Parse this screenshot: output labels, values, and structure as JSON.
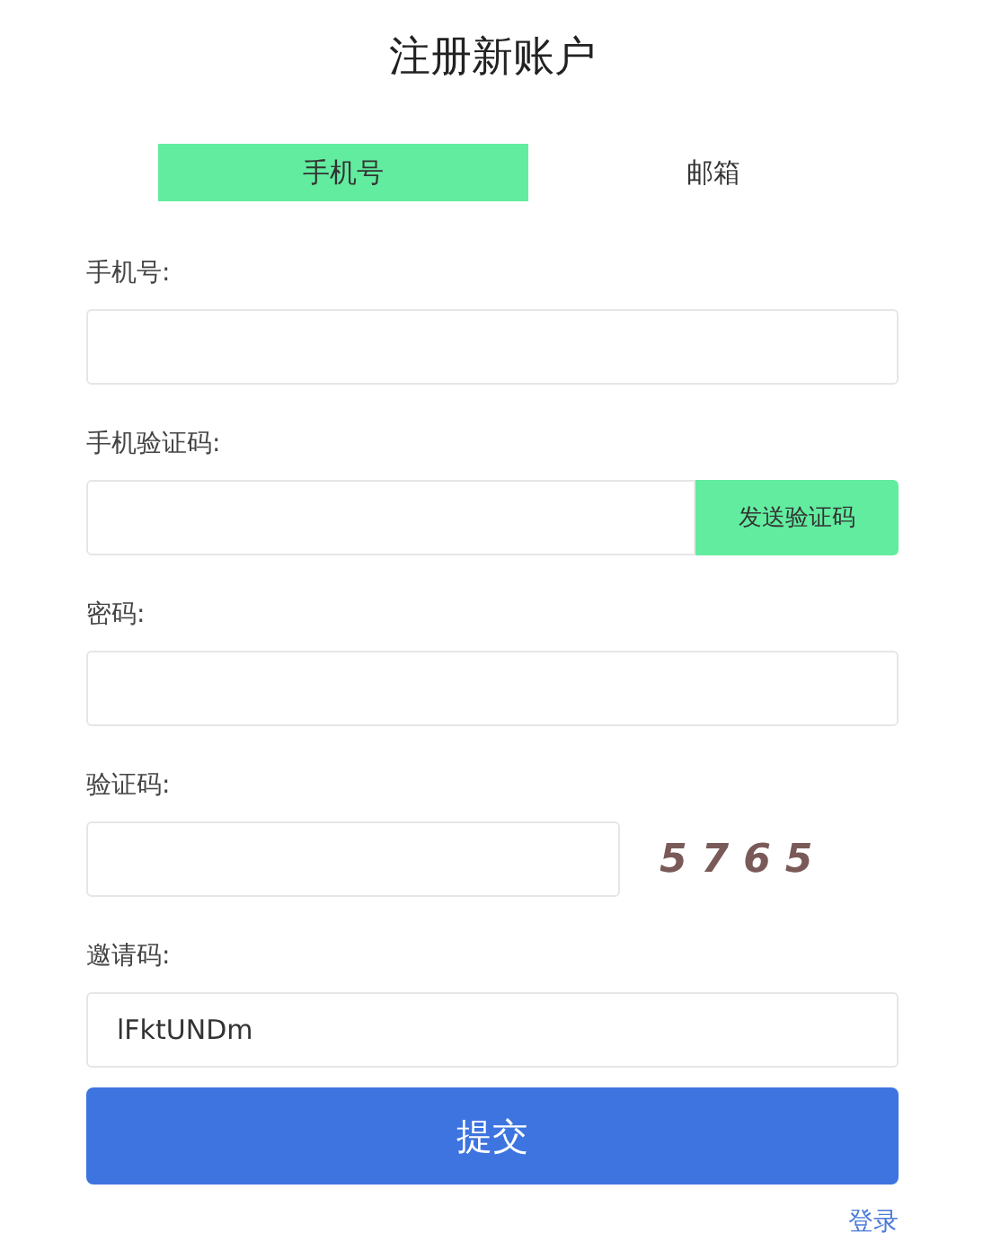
{
  "title": "注册新账户",
  "tabs": [
    {
      "label": "手机号",
      "selected": true
    },
    {
      "label": "邮箱",
      "selected": false
    }
  ],
  "fields": [
    {
      "kind": "text",
      "label": "手机号:"
    },
    {
      "kind": "sms",
      "label": "手机验证码:",
      "button": "发送验证码"
    },
    {
      "kind": "password",
      "label": "密码:"
    },
    {
      "kind": "captcha",
      "label": "验证码:",
      "captcha": "5765"
    },
    {
      "kind": "text",
      "label": "邀请码:",
      "value": "lFktUNDm"
    }
  ],
  "submit": "提交",
  "login_link": "登录"
}
